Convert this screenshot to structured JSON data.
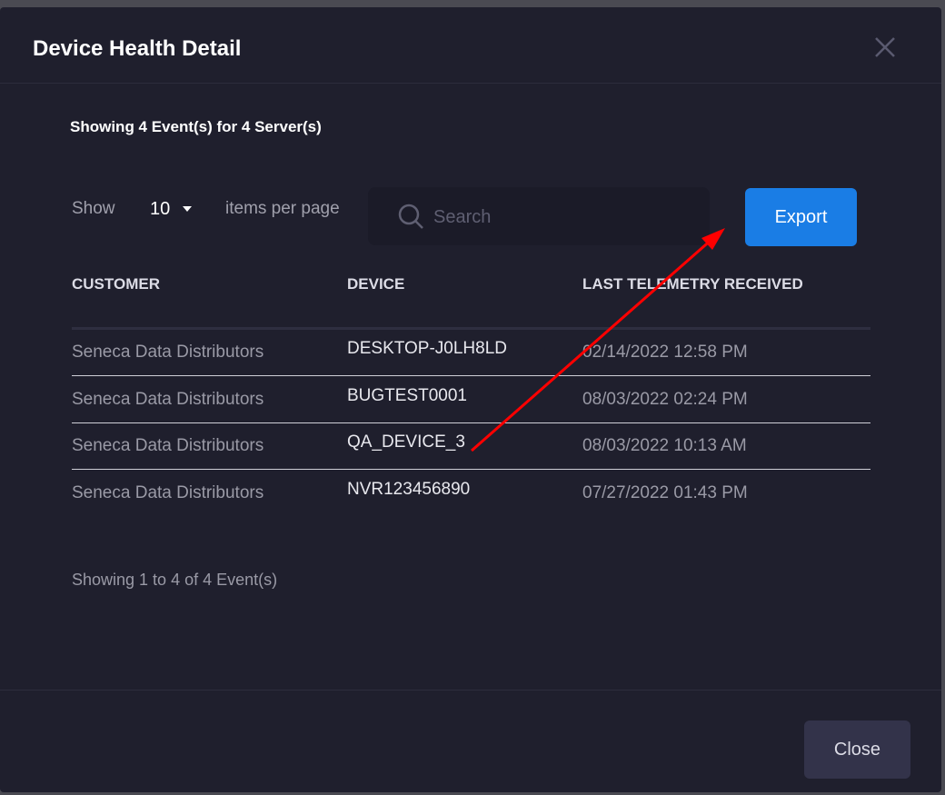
{
  "modal": {
    "title": "Device Health Detail",
    "summary": "Showing 4 Event(s) for 4 Server(s)",
    "show_label": "Show",
    "page_size": "10",
    "per_page_label": "items per page",
    "search_placeholder": "Search",
    "export_label": "Export",
    "columns": [
      "CUSTOMER",
      "DEVICE",
      "LAST TELEMETRY RECEIVED"
    ],
    "rows": [
      [
        "Seneca Data Distributors",
        "DESKTOP-J0LH8LD",
        "02/14/2022 12:58 PM"
      ],
      [
        "Seneca Data Distributors",
        "BUGTEST0001",
        "08/03/2022 02:24 PM"
      ],
      [
        "Seneca Data Distributors",
        "QA_DEVICE_3",
        "08/03/2022 10:13 AM"
      ],
      [
        "Seneca Data Distributors",
        "NVR123456890",
        "07/27/2022 01:43 PM"
      ]
    ],
    "footer_info": "Showing 1 to 4 of 4 Event(s)",
    "close_label": "Close"
  },
  "colors": {
    "accent": "#1a7de5",
    "annotation_arrow": "#ff0000"
  }
}
